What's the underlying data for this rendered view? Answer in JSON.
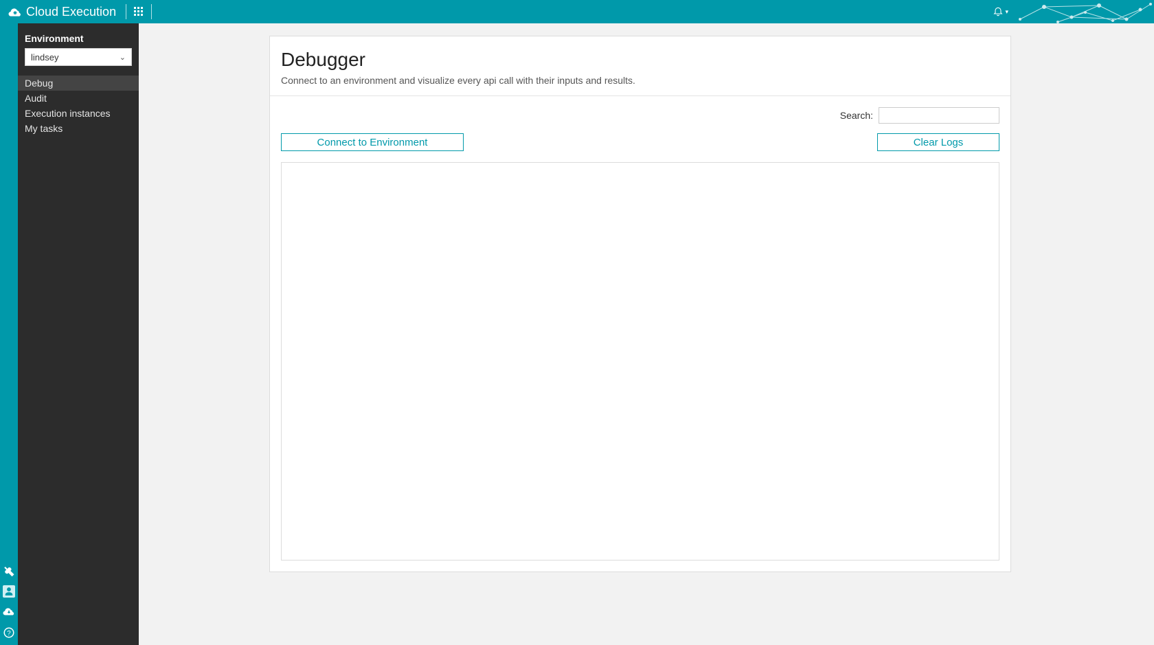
{
  "header": {
    "brand": "Cloud Execution"
  },
  "sidebar": {
    "section_label": "Environment",
    "selected_env": "lindsey",
    "items": [
      {
        "label": "Debug",
        "active": true
      },
      {
        "label": "Audit",
        "active": false
      },
      {
        "label": "Execution instances",
        "active": false
      },
      {
        "label": "My tasks",
        "active": false
      }
    ]
  },
  "main": {
    "title": "Debugger",
    "subtitle": "Connect to an environment and visualize every api call with their inputs and results.",
    "search_label": "Search:",
    "search_value": "",
    "connect_label": "Connect to Environment",
    "clear_label": "Clear Logs"
  },
  "colors": {
    "brand": "#0099aa",
    "sidebar_bg": "#2c2c2c",
    "page_bg": "#f2f2f2"
  }
}
